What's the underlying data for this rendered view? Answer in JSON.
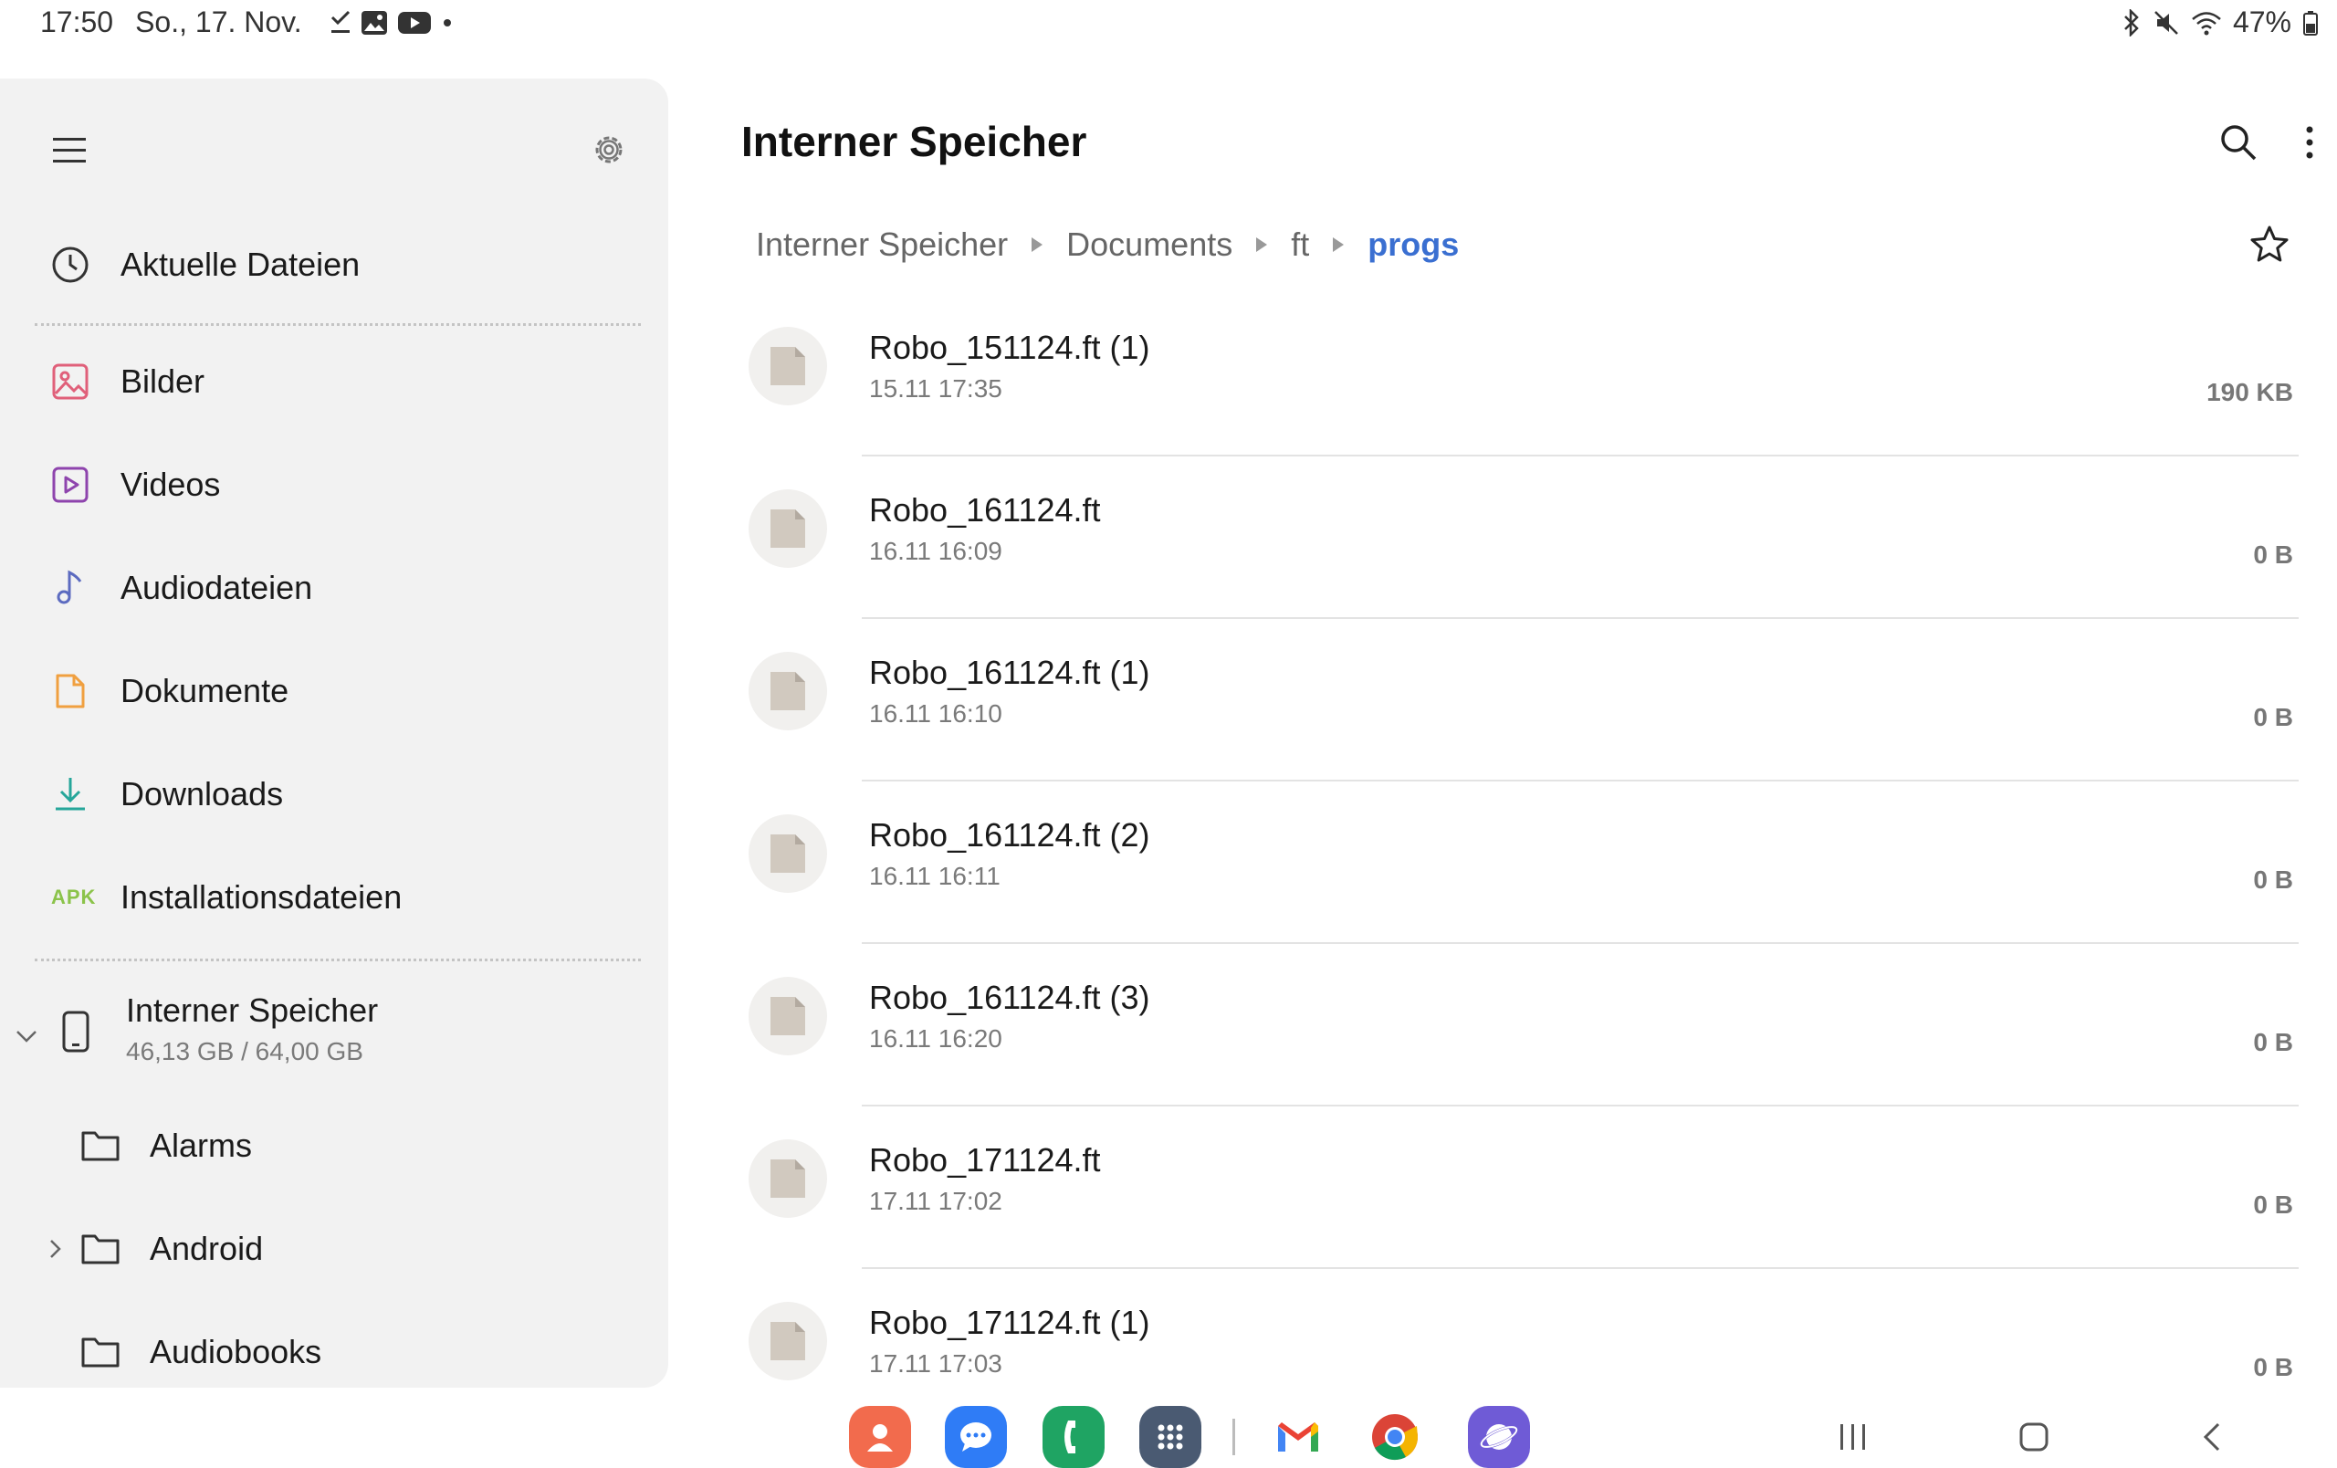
{
  "status_bar": {
    "time": "17:50",
    "date": "So., 17. Nov.",
    "left_icons": [
      "download-done-icon",
      "gallery-icon",
      "youtube-icon",
      "dot-icon"
    ],
    "battery": "47%",
    "right_icons": [
      "bluetooth-icon",
      "mute-icon",
      "wifi-icon",
      "battery-icon"
    ]
  },
  "sidebar": {
    "recent_label": "Aktuelle Dateien",
    "categories": [
      {
        "label": "Bilder",
        "icon": "image-icon",
        "color": "#e0607a"
      },
      {
        "label": "Videos",
        "icon": "video-icon",
        "color": "#8e44ad"
      },
      {
        "label": "Audiodateien",
        "icon": "music-note-icon",
        "color": "#5c6bc0"
      },
      {
        "label": "Dokumente",
        "icon": "document-icon",
        "color": "#f0a040"
      },
      {
        "label": "Downloads",
        "icon": "download-icon",
        "color": "#26a69a"
      },
      {
        "label": "Installationsdateien",
        "icon": "apk-icon",
        "badge": "APK",
        "color": "#8bc34a"
      }
    ],
    "storage": {
      "title": "Interner Speicher",
      "usage": "46,13 GB / 64,00 GB"
    },
    "folders": [
      {
        "label": "Alarms",
        "expandable": false
      },
      {
        "label": "Android",
        "expandable": true
      },
      {
        "label": "Audiobooks",
        "expandable": false
      }
    ]
  },
  "main": {
    "title": "Interner Speicher",
    "breadcrumb": [
      "Interner Speicher",
      "Documents",
      "ft",
      "progs"
    ],
    "files": [
      {
        "name": "Robo_151124.ft (1)",
        "date": "15.11 17:35",
        "size": "190 KB"
      },
      {
        "name": "Robo_161124.ft",
        "date": "16.11 16:09",
        "size": "0 B"
      },
      {
        "name": "Robo_161124.ft (1)",
        "date": "16.11 16:10",
        "size": "0 B"
      },
      {
        "name": "Robo_161124.ft (2)",
        "date": "16.11 16:11",
        "size": "0 B"
      },
      {
        "name": "Robo_161124.ft (3)",
        "date": "16.11 16:20",
        "size": "0 B"
      },
      {
        "name": "Robo_171124.ft",
        "date": "17.11 17:02",
        "size": "0 B"
      },
      {
        "name": "Robo_171124.ft (1)",
        "date": "17.11 17:03",
        "size": "0 B"
      }
    ]
  },
  "dock": {
    "apps": [
      {
        "name": "contacts-icon",
        "color": "#f26b4d"
      },
      {
        "name": "messages-icon",
        "color": "#2f7cf6"
      },
      {
        "name": "phone-icon",
        "color": "#1fa463"
      },
      {
        "name": "apps-grid-icon",
        "color": "#4a5a72"
      },
      {
        "name": "gmail-icon",
        "color": "#ffffff"
      },
      {
        "name": "chrome-icon",
        "color": "#ffffff"
      },
      {
        "name": "samsung-internet-icon",
        "color": "#6f5bd6"
      }
    ],
    "nav": [
      "recents-icon",
      "home-icon",
      "back-icon"
    ]
  },
  "colors": {
    "accent": "#3a6fd1",
    "sidebar_bg": "#f2f2f2"
  }
}
